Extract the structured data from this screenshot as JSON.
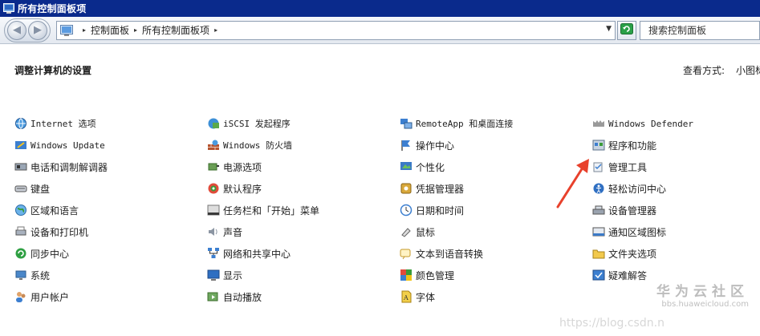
{
  "window": {
    "title": "所有控制面板项"
  },
  "nav": {
    "back_glyph": "◀",
    "forward_glyph": "▶",
    "breadcrumbs": [
      "控制面板",
      "所有控制面板项"
    ],
    "search_placeholder": "搜索控制面板"
  },
  "main": {
    "heading": "调整计算机的设置",
    "view_by_label": "查看方式:",
    "view_by_value": "小图标"
  },
  "items": {
    "col1": [
      {
        "label": "Internet 选项",
        "icon": "internet-options-icon",
        "mono": true
      },
      {
        "label": "Windows Update",
        "icon": "windows-update-icon",
        "mono": true
      },
      {
        "label": "电话和调制解调器",
        "icon": "phone-modem-icon",
        "mono": false
      },
      {
        "label": "键盘",
        "icon": "keyboard-icon",
        "mono": false
      },
      {
        "label": "区域和语言",
        "icon": "region-language-icon",
        "mono": false
      },
      {
        "label": "设备和打印机",
        "icon": "devices-printers-icon",
        "mono": false
      },
      {
        "label": "同步中心",
        "icon": "sync-center-icon",
        "mono": false
      },
      {
        "label": "系统",
        "icon": "system-icon",
        "mono": false
      },
      {
        "label": "用户帐户",
        "icon": "user-accounts-icon",
        "mono": false
      }
    ],
    "col2": [
      {
        "label": "iSCSI 发起程序",
        "icon": "iscsi-icon",
        "mono": true
      },
      {
        "label": "Windows 防火墙",
        "icon": "firewall-icon",
        "mono": true
      },
      {
        "label": "电源选项",
        "icon": "power-options-icon",
        "mono": false
      },
      {
        "label": "默认程序",
        "icon": "default-programs-icon",
        "mono": false
      },
      {
        "label": "任务栏和「开始」菜单",
        "icon": "taskbar-start-icon",
        "mono": false
      },
      {
        "label": "声音",
        "icon": "sound-icon",
        "mono": false
      },
      {
        "label": "网络和共享中心",
        "icon": "network-sharing-icon",
        "mono": false
      },
      {
        "label": "显示",
        "icon": "display-icon",
        "mono": false
      },
      {
        "label": "自动播放",
        "icon": "autoplay-icon",
        "mono": false
      }
    ],
    "col3": [
      {
        "label": "RemoteApp 和桌面连接",
        "icon": "remoteapp-icon",
        "mono": true
      },
      {
        "label": "操作中心",
        "icon": "action-center-icon",
        "mono": false
      },
      {
        "label": "个性化",
        "icon": "personalization-icon",
        "mono": false
      },
      {
        "label": "凭据管理器",
        "icon": "credential-manager-icon",
        "mono": false
      },
      {
        "label": "日期和时间",
        "icon": "date-time-icon",
        "mono": false
      },
      {
        "label": "鼠标",
        "icon": "mouse-icon",
        "mono": false
      },
      {
        "label": "文本到语音转换",
        "icon": "text-to-speech-icon",
        "mono": false
      },
      {
        "label": "颜色管理",
        "icon": "color-management-icon",
        "mono": false
      },
      {
        "label": "字体",
        "icon": "fonts-icon",
        "mono": false
      }
    ],
    "col4": [
      {
        "label": "Windows Defender",
        "icon": "windows-defender-icon",
        "mono": true
      },
      {
        "label": "程序和功能",
        "icon": "programs-features-icon",
        "mono": false
      },
      {
        "label": "管理工具",
        "icon": "admin-tools-icon",
        "mono": false
      },
      {
        "label": "轻松访问中心",
        "icon": "ease-of-access-icon",
        "mono": false
      },
      {
        "label": "设备管理器",
        "icon": "device-manager-icon",
        "mono": false
      },
      {
        "label": "通知区域图标",
        "icon": "notification-icons-icon",
        "mono": false
      },
      {
        "label": "文件夹选项",
        "icon": "folder-options-icon",
        "mono": false
      },
      {
        "label": "疑难解答",
        "icon": "troubleshooting-icon",
        "mono": false
      }
    ]
  },
  "watermark": {
    "brand": "华为云社区",
    "site": "bbs.huaweicloud.com",
    "url": "https://blog.csdn.n"
  },
  "colors": {
    "titlebar": "#0a2a8c",
    "annotation_arrow": "#e8412c"
  }
}
